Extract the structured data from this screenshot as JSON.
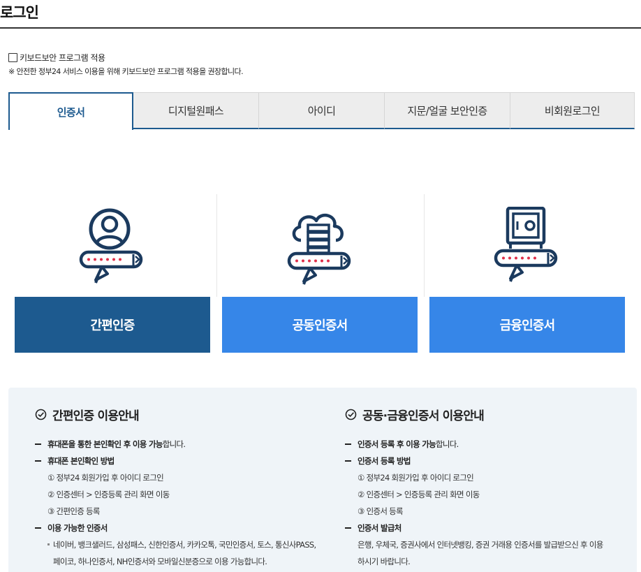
{
  "page": {
    "title": "로그인"
  },
  "keyboard": {
    "checkbox_label": "키보드보안 프로그램 적용",
    "checked": false,
    "notice": "※ 안전한 정부24 서비스 이용을 위해 키보드보안 프로그램 적용을 권장합니다."
  },
  "tabs": [
    {
      "label": "인증서",
      "active": true
    },
    {
      "label": "디지털원패스",
      "active": false
    },
    {
      "label": "아이디",
      "active": false
    },
    {
      "label": "지문/얼굴 보안인증",
      "active": false
    },
    {
      "label": "비회원로그인",
      "active": false
    }
  ],
  "cards": [
    {
      "label": "간편인증",
      "icon": "person-icon",
      "color": "#1d5a8f"
    },
    {
      "label": "공동인증서",
      "icon": "cloud-server-icon",
      "color": "#3686e8"
    },
    {
      "label": "금융인증서",
      "icon": "safe-icon",
      "color": "#3686e8"
    }
  ],
  "guide_left": {
    "title": "간편인증 이용안내",
    "item1_bold": "휴대폰을 통한 본인확인 후 이용 가능",
    "item1_rest": "합니다.",
    "item2": "휴대폰 본인확인 방법",
    "steps": [
      "① 정부24 회원가입 후 아이디 로그인",
      "② 인증센터 > 인증등록 관리 화면 이동",
      "③ 간편인증 등록"
    ],
    "item3": "이용 가능한 인증서",
    "certs_line1": "네이버, 뱅크샐러드, 삼성패스, 신한인증서, 카카오톡, 국민인증서, 토스, 통신사PASS,",
    "certs_line2": "페이코, 하나인증서, NH인증서와 모바일신분증으로 이용 가능합니다."
  },
  "guide_right": {
    "title": "공동·금융인증서 이용안내",
    "item1_bold": "인증서 등록 후 이용 가능",
    "item1_rest": "합니다.",
    "item2": "인증서 등록 방법",
    "steps": [
      "① 정부24 회원가입 후 아이디 로그인",
      "② 인증센터 > 인증등록 관리 화면 이동",
      "③ 인증서 등록"
    ],
    "item3": "인증서 발급처",
    "issuer_line1": "은행, 우체국, 증권사에서 인터넷뱅킹, 증권 거래용 인증서를 발급받으신 후 이용",
    "issuer_line2": "하시기 바랍니다."
  },
  "colors": {
    "primary": "#1d5a8f",
    "accent": "#3686e8",
    "alert_red": "#e0304a",
    "guide_bg": "#eff4f8"
  }
}
